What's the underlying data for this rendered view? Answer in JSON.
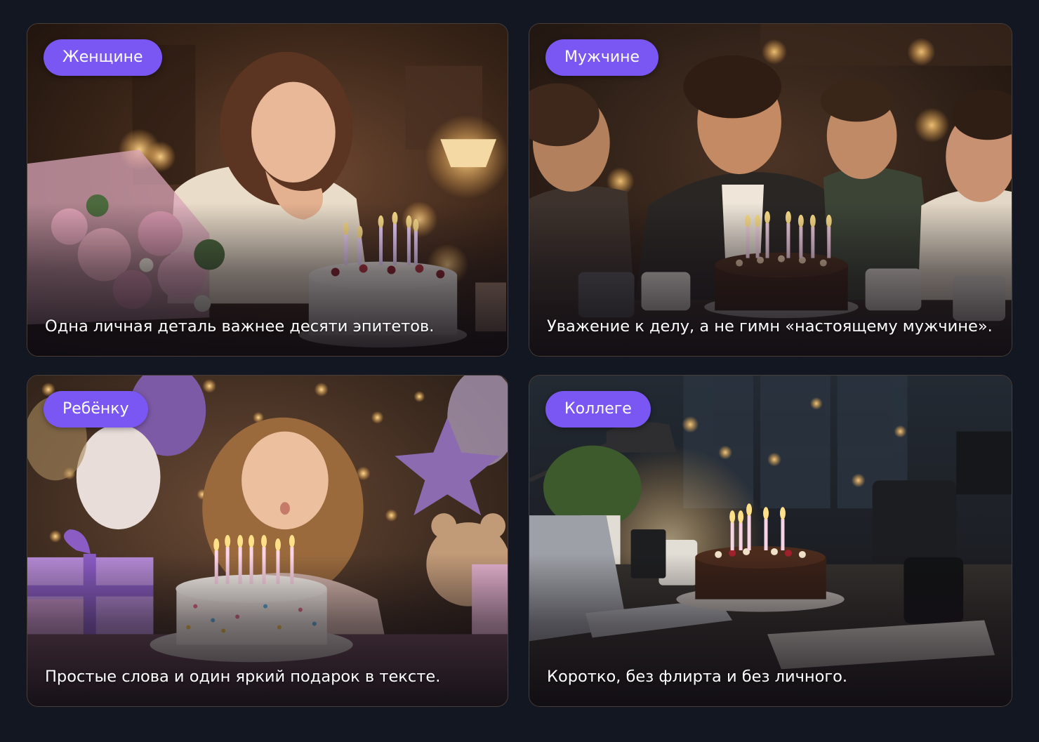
{
  "cards": [
    {
      "tag": "Женщине",
      "caption": "Одна личная деталь важнее десяти эпитетов.",
      "accent": "#7a56f2"
    },
    {
      "tag": "Мужчине",
      "caption": "Уважение к делу, а не гимн «настоящему мужчине».",
      "accent": "#7a56f2"
    },
    {
      "tag": "Ребёнку",
      "caption": "Простые слова и один яркий подарок в тексте.",
      "accent": "#7a56f2"
    },
    {
      "tag": "Коллеге",
      "caption": "Коротко, без флирта и без личного.",
      "accent": "#7a56f2"
    }
  ],
  "colors": {
    "background": "#131722",
    "pill": "#7a56f2",
    "text": "#ffffff"
  }
}
